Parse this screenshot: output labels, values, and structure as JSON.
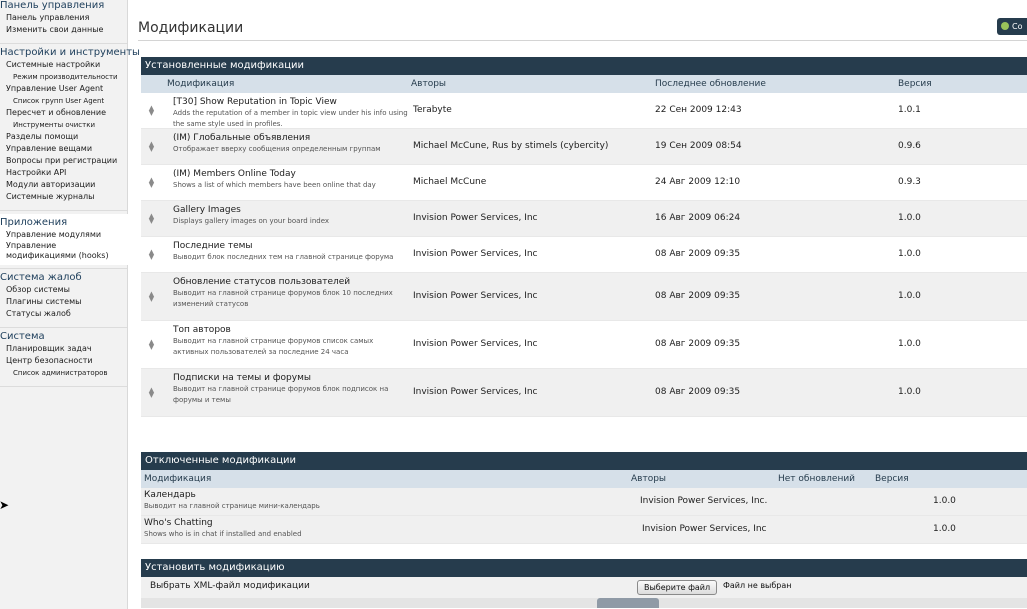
{
  "sidebar": {
    "groups": [
      {
        "title": "Панель управления",
        "items": [
          {
            "label": "Панель управления",
            "sub": false
          },
          {
            "label": "Изменить свои данные",
            "sub": false
          }
        ]
      },
      {
        "title": "Настройки и инструменты",
        "items": [
          {
            "label": "Системные настройки",
            "sub": false
          },
          {
            "label": "Режим производительности",
            "sub": true
          },
          {
            "label": "Управление User Agent",
            "sub": false
          },
          {
            "label": "Список групп User Agent",
            "sub": true
          },
          {
            "label": "Пересчет и обновление",
            "sub": false
          },
          {
            "label": "Инструменты очистки",
            "sub": true
          },
          {
            "label": "Разделы помощи",
            "sub": false
          },
          {
            "label": "Управление вещами",
            "sub": false
          },
          {
            "label": "Вопросы при регистрации",
            "sub": false
          },
          {
            "label": "Настройки API",
            "sub": false
          },
          {
            "label": "Модули авторизации",
            "sub": false
          },
          {
            "label": "Системные журналы",
            "sub": false
          }
        ]
      },
      {
        "title": "Приложения",
        "active": true,
        "items": [
          {
            "label": "Управление модулями",
            "sub": false
          },
          {
            "label": "Управление модификациями (hooks)",
            "sub": false
          }
        ]
      },
      {
        "title": "Система жалоб",
        "items": [
          {
            "label": "Обзор системы",
            "sub": false
          },
          {
            "label": "Плагины системы",
            "sub": false
          },
          {
            "label": "Статусы жалоб",
            "sub": false
          }
        ]
      },
      {
        "title": "Система",
        "items": [
          {
            "label": "Планировщик задач",
            "sub": false
          },
          {
            "label": "Центр безопасности",
            "sub": false
          },
          {
            "label": "Список администраторов",
            "sub": true
          }
        ]
      }
    ]
  },
  "header": {
    "title": "Модификации",
    "top_button": "Со"
  },
  "installed": {
    "title": "Установленные модификации",
    "columns": [
      "Модификация",
      "Авторы",
      "Последнее обновление",
      "Версия"
    ],
    "rows": [
      {
        "name": "[T30] Show Reputation in Topic View",
        "desc": "Adds the reputation of a member in topic view under his info using the same style used in profiles.",
        "author": "Terabyte",
        "updated": "22 Сен 2009 12:43",
        "version": "1.0.1"
      },
      {
        "name": "(IM) Глобальные объявления",
        "desc": "Отображает вверху сообщения определенным группам",
        "author": "Michael McCune, Rus by stimels (cybercity)",
        "updated": "19 Сен 2009 08:54",
        "version": "0.9.6"
      },
      {
        "name": "(IM) Members Online Today",
        "desc": "Shows a list of which members have been online that day",
        "author": "Michael McCune",
        "updated": "24 Авг 2009 12:10",
        "version": "0.9.3"
      },
      {
        "name": "Gallery Images",
        "desc": "Displays gallery images on your board index",
        "author": "Invision Power Services, Inc",
        "updated": "16 Авг 2009 06:24",
        "version": "1.0.0"
      },
      {
        "name": "Последние темы",
        "desc": "Выводит блок последних тем на главной странице форума",
        "author": "Invision Power Services, Inc",
        "updated": "08 Авг 2009 09:35",
        "version": "1.0.0"
      },
      {
        "name": "Обновление статусов пользователей",
        "desc": "Выводит на главной странице форумов блок 10 последних изменений статусов",
        "author": "Invision Power Services, Inc",
        "updated": "08 Авг 2009 09:35",
        "version": "1.0.0"
      },
      {
        "name": "Топ авторов",
        "desc": "Выводит на главной странице форумов список самых активных пользователей за последние 24 часа",
        "author": "Invision Power Services, Inc",
        "updated": "08 Авг 2009 09:35",
        "version": "1.0.0"
      },
      {
        "name": "Подписки на темы и форумы",
        "desc": "Выводит на главной странице форумов блок подписок на форумы и темы",
        "author": "Invision Power Services, Inc",
        "updated": "08 Авг 2009 09:35",
        "version": "1.0.0"
      }
    ]
  },
  "disabled": {
    "title": "Отключенные модификации",
    "columns": [
      "Модификация",
      "Авторы",
      "Нет обновлений",
      "Версия"
    ],
    "rows": [
      {
        "name": "Календарь",
        "desc": "Выводит на главной странице мини-календарь",
        "author": "Invision Power Services, Inc.",
        "version": "1.0.0"
      },
      {
        "name": "Who's Chatting",
        "desc": "Shows who is in chat if installed and enabled",
        "author": "Invision Power Services, Inc",
        "version": "1.0.0"
      }
    ]
  },
  "install": {
    "title": "Установить модификацию",
    "label": "Выбрать XML-файл модификации",
    "file_button": "Выберите файл",
    "file_status": "Файл не выбран"
  },
  "colors": {
    "section_header": "#263c4d",
    "column_header": "#d6e0e9",
    "sidebar_bg": "#f2f2f2"
  }
}
